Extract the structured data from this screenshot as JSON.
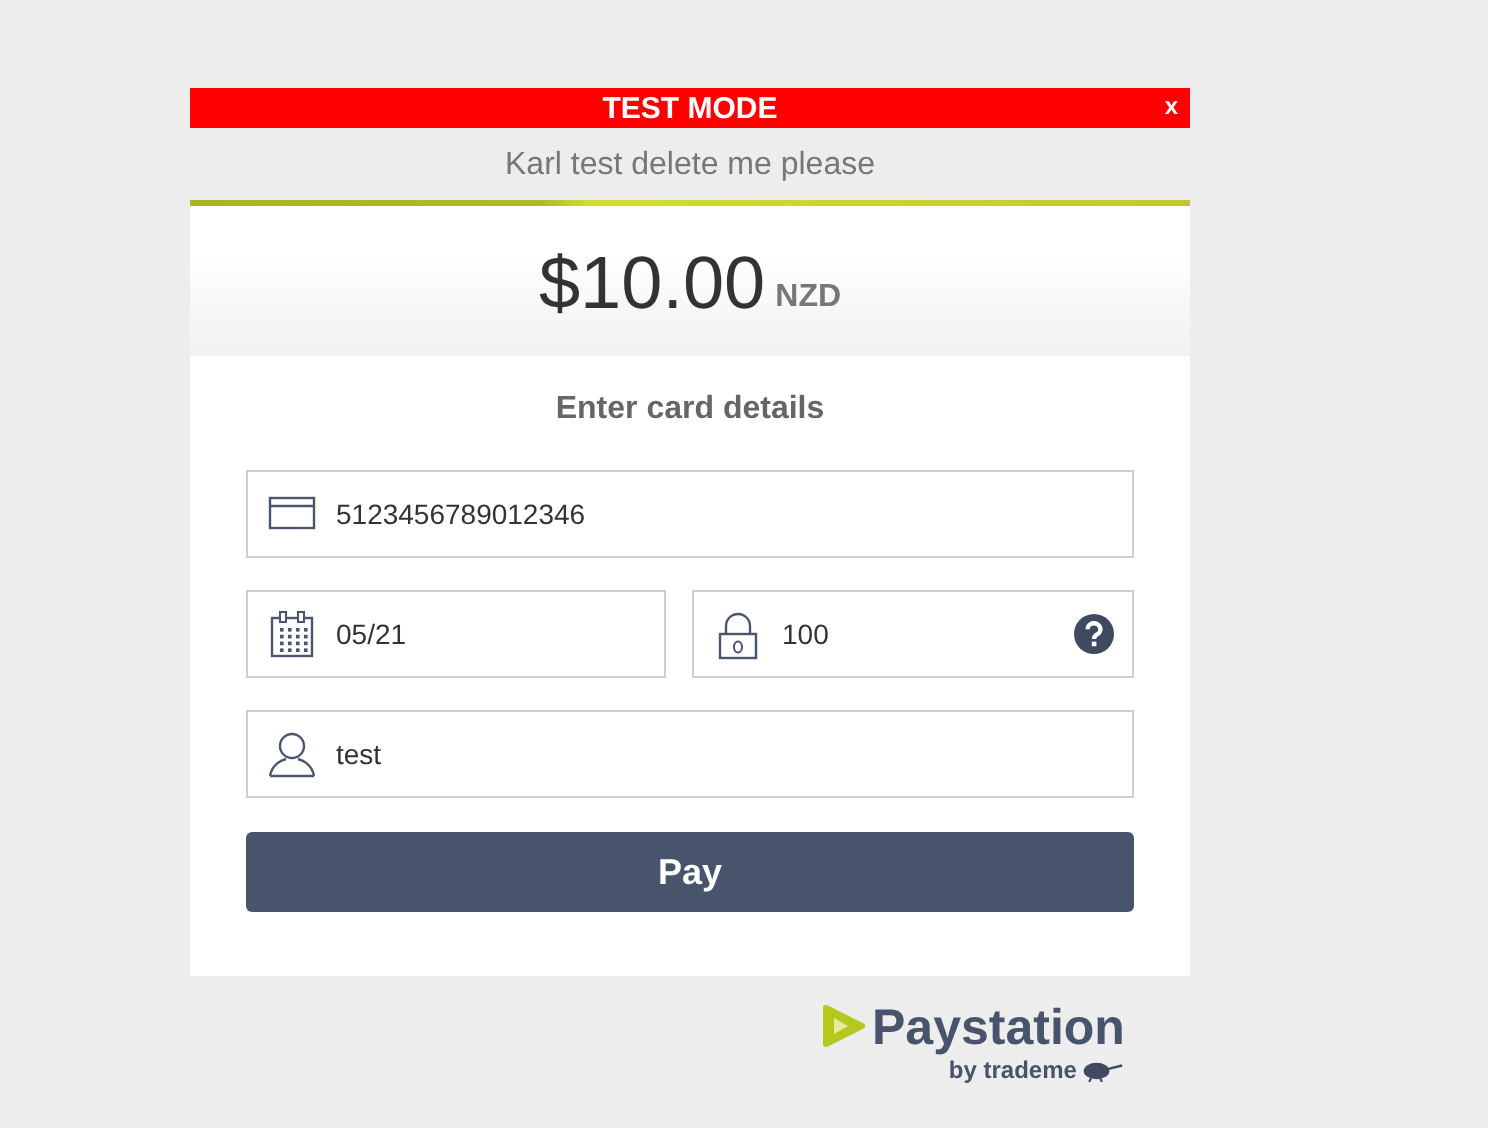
{
  "test_banner": {
    "label": "TEST MODE",
    "close": "x"
  },
  "merchant": "Karl test delete me please",
  "amount": {
    "value": "$10.00",
    "currency": "NZD"
  },
  "form": {
    "heading": "Enter card details",
    "fields": [
      {
        "kind": "card",
        "value": "5123456789012346"
      },
      {
        "kind": "expiry",
        "value": "05/21"
      },
      {
        "kind": "cvc",
        "value": "100"
      },
      {
        "kind": "name",
        "value": "test"
      }
    ],
    "pay": "Pay"
  },
  "footer": {
    "brand": "Paystation",
    "byline": "by trademe"
  }
}
